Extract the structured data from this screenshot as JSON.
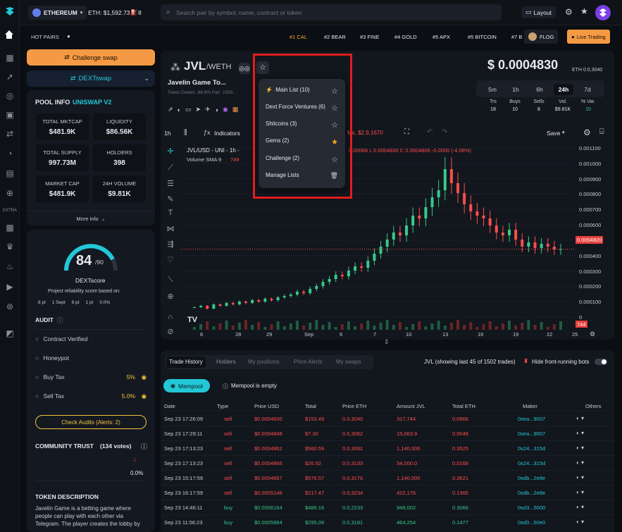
{
  "topbar": {
    "chain": "ETHEREUM",
    "eth_price": "ETH: $1,592.73",
    "gas": "8",
    "search_placeholder": "Search pair by symbol, name, contract or token",
    "layout_label": "Layout"
  },
  "hot_pairs": {
    "label": "HOT PAIRS",
    "items": [
      "#1 CAL",
      "#2 BEAR",
      "#3 FINE",
      "#4 GOLD",
      "#5 APX",
      "#5 BITCOIN",
      "#7 B"
    ],
    "flog": "FLOG",
    "live": "Live Trading"
  },
  "left": {
    "challenge_btn": "Challenge swap",
    "dextswap": "DEXTswap",
    "pool_info": "POOL INFO",
    "pool_dex": "UNISWAP V2",
    "stats": [
      {
        "label": "TOTAL MKTCAP",
        "value": "$481.9K"
      },
      {
        "label": "LIQUIDITY",
        "value": "$86.56K"
      },
      {
        "label": "TOTAL SUPPLY",
        "value": "997.73M"
      },
      {
        "label": "HOLDERS",
        "value": "398"
      },
      {
        "label": "MARKET CAP",
        "value": "$481.9K"
      },
      {
        "label": "24H VOLUME",
        "value": "$9.81K"
      }
    ],
    "more_info": "More info",
    "score": "84",
    "score_max": "/90",
    "score_name": "DEXTscore",
    "score_desc": "Project reliability score based on:",
    "score_parts": [
      "8 pt",
      "1 Sept",
      "9 pt",
      "1 pt",
      "0.0%"
    ],
    "audit_title": "AUDIT",
    "audit_rows": [
      {
        "label": "Contract Verified",
        "value": ""
      },
      {
        "label": "Honeypot",
        "value": ""
      },
      {
        "label": "Buy Tax",
        "value": "5%"
      },
      {
        "label": "Sell Tax",
        "value": "5.0%"
      }
    ],
    "check_audits": "Check Audits  (Alerts: 2)",
    "community_title": "COMMUNITY TRUST",
    "community_votes": "(134 votes)",
    "community_pct": "0.0%",
    "token_desc_title": "TOKEN DESCRIPTION",
    "token_desc": "Javelin Game is a betting game where people can play with each other via Telegram. The player creates the lobby by"
  },
  "pair": {
    "symbol": "JVL",
    "quote": "/WETH",
    "name": "Javelin Game To...",
    "sub": "Token Details  .88.8%     Pair: 1000..",
    "price": "$ 0.0004830",
    "price_eth": "ETH 0.0,3040",
    "timeframes": [
      "5m",
      "1h",
      "6h",
      "24h",
      "7d"
    ],
    "active_tf": "24h",
    "metrics": [
      {
        "label": "Trs",
        "value": "18"
      },
      {
        "label": "Buys",
        "value": "10"
      },
      {
        "label": "Sells",
        "value": "8"
      },
      {
        "label": "Vol.",
        "value": "$9.81K"
      },
      {
        "label": "% Var.",
        "value": "10"
      }
    ]
  },
  "chart_toolbar": {
    "interval": "1h",
    "indicators": "Indicators",
    "mx": "Mx, $2.9,1670",
    "save": "Save"
  },
  "chart_data": {
    "type": "line",
    "title": "JVL/USD - UNI - 1h -",
    "ohlc": "0.00066 L 0.0004830 C 0.0004809 -0.0000 (-4.08%)",
    "volume_label": "Volume SMA 9",
    "volume_value": "749",
    "y_ticks": [
      "0.001100",
      "0.001000",
      "0.000900",
      "0.000800",
      "0.000700",
      "0.000600",
      "0.000500",
      "0.000400",
      "0.000300",
      "0.000200",
      "0.000100",
      "0"
    ],
    "ylim": [
      0,
      0.0012
    ],
    "x_ticks": [
      "6",
      "28",
      "29",
      "Sep",
      "6",
      "7",
      "10",
      "13",
      "16",
      "19",
      "22",
      "25"
    ],
    "last_price_label": "0.0004820",
    "last_price": 0.000482,
    "volume_tag": "744",
    "x": [
      0,
      10,
      20,
      30,
      40,
      50,
      60,
      70,
      80,
      90,
      100,
      110,
      120,
      130,
      140,
      150,
      160,
      170,
      180,
      190,
      200,
      210,
      220,
      230,
      240,
      250,
      260,
      270,
      280,
      290,
      300,
      310,
      320,
      330,
      340,
      350,
      360,
      370,
      380,
      390,
      400,
      410,
      420,
      430,
      440,
      450,
      460,
      470,
      480,
      490,
      500,
      510,
      520,
      530,
      540,
      550,
      560,
      570
    ],
    "values": [
      7e-05,
      8e-05,
      6e-05,
      9e-05,
      8e-05,
      0.0001,
      9e-05,
      0.00011,
      0.0001,
      0.00012,
      0.00011,
      0.00013,
      0.00012,
      0.00014,
      0.00015,
      0.00016,
      0.00018,
      0.00017,
      0.0002,
      0.00022,
      0.00025,
      0.00027,
      0.0003,
      0.00029,
      0.00033,
      0.00036,
      0.00035,
      0.0004,
      0.00045,
      0.0005,
      0.00055,
      0.0006,
      0.00058,
      0.00065,
      0.00072,
      0.0007,
      0.00078,
      0.00085,
      0.0009,
      0.00105,
      0.00095,
      0.00088,
      0.0008,
      0.00075,
      0.00072,
      0.0007,
      0.00065,
      0.0006,
      0.00058,
      0.00062,
      0.00055,
      0.0005,
      0.00053,
      0.00049,
      0.00052,
      0.0005,
      0.00048,
      0.000482
    ]
  },
  "watchlist_popup": {
    "items": [
      {
        "label": "Main List (10)",
        "starred": false
      },
      {
        "label": "Dext Force Ventures (6)",
        "starred": false
      },
      {
        "label": "Shitcoins (3)",
        "starred": false
      },
      {
        "label": "Gems (2)",
        "starred": true
      },
      {
        "label": "Challenge (2)",
        "starred": false
      },
      {
        "label": "Manage Lists",
        "starred": false
      }
    ]
  },
  "trades": {
    "tabs": [
      "Trade History",
      "Holders",
      "My positions",
      "Price Alerts",
      "My swaps"
    ],
    "active_tab": "Trade History",
    "showing": "JVL (showing last 45 of 1502 trades)",
    "hide_bots": "Hide front-running bots",
    "mempool_btn": "Mempool",
    "mempool_status": "Mempool is empty",
    "headers": [
      "Date",
      "Type",
      "Price USD",
      "Total",
      "Price ETH",
      "Amount JVL",
      "Total ETH",
      "Maker",
      "Others"
    ],
    "rows": [
      {
        "date": "Sep 23 17:26:09",
        "type": "sell",
        "usd": "$0.0004830",
        "total": "$153.49",
        "eth": "0.0,3040",
        "amount": "317,744",
        "teth": "0.0966",
        "maker": "0xea...9007"
      },
      {
        "date": "Sep 23 17:29:11",
        "type": "sell",
        "usd": "$0.0004848",
        "total": "$7.30",
        "eth": "0.0,3062",
        "amount": "15,063.9",
        "teth": "0.0048",
        "maker": "0xea...9007"
      },
      {
        "date": "Sep 23 17:13:23",
        "type": "sell",
        "usd": "$0.0004862",
        "total": "$560.59",
        "eth": "0.0,3062",
        "amount": "1,140,000",
        "teth": "0.3525",
        "maker": "0x24...315d"
      },
      {
        "date": "Sep 23 17:13:23",
        "type": "sell",
        "usd": "$0.0004866",
        "total": "$26.92",
        "eth": "0.0,3133",
        "amount": "54,000.0",
        "teth": "0.0168",
        "maker": "0x24...315d"
      },
      {
        "date": "Sep 23 15:17:59",
        "type": "sell",
        "usd": "$0.0004667",
        "total": "$576.57",
        "eth": "0.0,3176",
        "amount": "1,140,000",
        "teth": "0.3621",
        "maker": "0xdb...2e8e"
      },
      {
        "date": "Sep 23 16:17:59",
        "type": "sell",
        "usd": "$0.0005148",
        "total": "$217.47",
        "eth": "0.0,3234",
        "amount": "422,176",
        "teth": "0.1365",
        "maker": "0xdb...2e8e"
      },
      {
        "date": "Sep 23 14:46:11",
        "type": "buy",
        "usd": "$0.0006164",
        "total": "$489.16",
        "eth": "0.0,2233",
        "amount": "948,002",
        "teth": "0.3066",
        "maker": "0xd3...5000"
      },
      {
        "date": "Sep 23 11:56:23",
        "type": "buy",
        "usd": "$0.0005984",
        "total": "$295.09",
        "eth": "0.0,3181",
        "amount": "464,254",
        "teth": "0.1477",
        "maker": "0xd0...50e0"
      }
    ]
  },
  "colors": {
    "accent_orange": "#f59a44",
    "accent_cyan": "#23c8d8",
    "sell_red": "#ff4d4d",
    "buy_green": "#36c98a",
    "highlight_box": "#e01e1e"
  }
}
